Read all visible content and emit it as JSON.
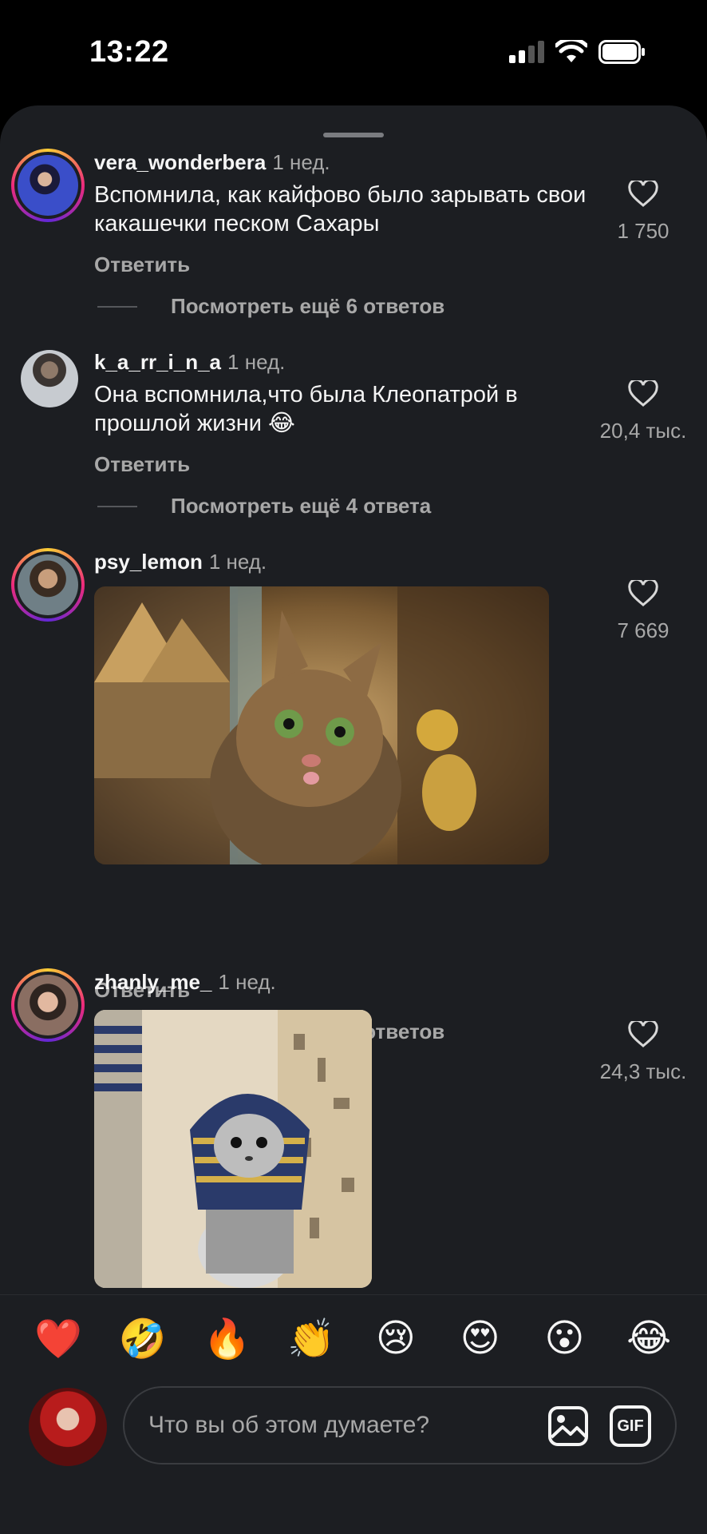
{
  "status_bar": {
    "time": "13:22"
  },
  "comments": [
    {
      "username": "vera_wonderbera",
      "time": "1 нед.",
      "text": "Вспомнила, как кайфово было зарывать свои какашечки песком Сахары",
      "likes": "1 750",
      "reply_label": "Ответить",
      "more_replies": "Посмотреть ещё 6 ответов"
    },
    {
      "username": "k_a_rr_i_n_a",
      "time": "1 нед.",
      "text": "Она вспомнила,что была  Клеопатрой в прошлой жизни 😂",
      "likes": "20,4 тыс.",
      "reply_label": "Ответить",
      "more_replies": "Посмотреть ещё 4 ответа"
    },
    {
      "username": "psy_lemon",
      "time": "1 нед.",
      "likes": "7 669",
      "reply_label": "Ответить",
      "more_replies": "Посмотреть ещё 7 ответов"
    },
    {
      "username": "zhanly_me_",
      "time": "1 нед.",
      "likes": "24,3 тыс."
    }
  ],
  "reactions": [
    "❤️",
    "🤣",
    "🔥",
    "👏",
    "😢",
    "😍",
    "😮",
    "😂"
  ],
  "composer": {
    "placeholder": "Что вы об этом думаете?",
    "gif_label": "GIF"
  },
  "colors": {
    "sheet_bg": "#1c1e22",
    "secondary_text": "#a8a8a8"
  }
}
